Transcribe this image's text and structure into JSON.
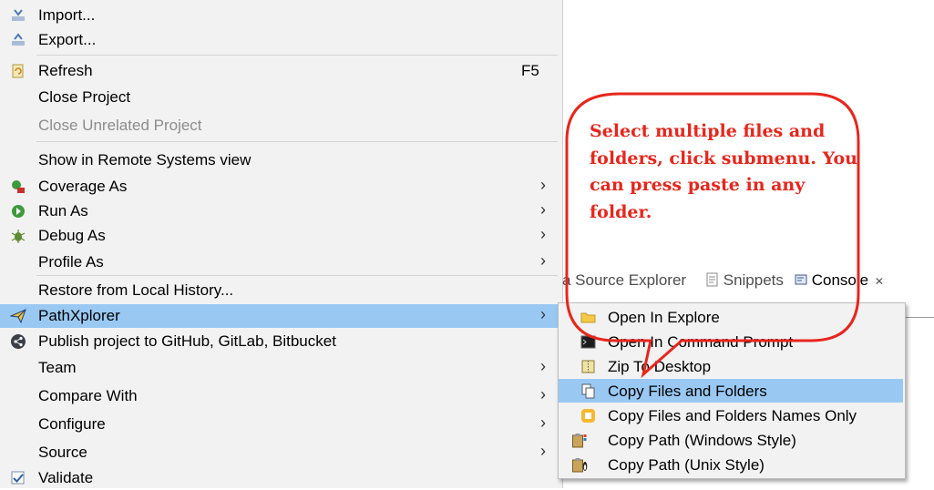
{
  "menu": {
    "import": "Import...",
    "export": "Export...",
    "refresh": "Refresh",
    "refresh_shortcut": "F5",
    "close_project": "Close Project",
    "close_unrelated_project": "Close Unrelated Project",
    "show_remote": "Show in Remote Systems view",
    "coverage_as": "Coverage As",
    "run_as": "Run As",
    "debug_as": "Debug As",
    "profile_as": "Profile As",
    "restore_history": "Restore from Local History...",
    "pathxplorer": "PathXplorer",
    "publish": "Publish project to GitHub, GitLab, Bitbucket",
    "team": "Team",
    "compare_with": "Compare With",
    "configure": "Configure",
    "source": "Source",
    "validate": "Validate",
    "arrow": "›"
  },
  "tabs": {
    "source_explorer": "a Source Explorer",
    "snippets": "Snippets",
    "console": "Console",
    "close": "✕"
  },
  "submenu": {
    "open_explore": "Open In Explore",
    "open_cmd": "Open In Command Prompt",
    "zip_desktop": "Zip To Desktop",
    "copy_files": "Copy Files and Folders",
    "copy_names": "Copy Files and Folders Names Only",
    "copy_windows": "Copy Path (Windows Style)",
    "copy_unix": "Copy Path (Unix Style)"
  },
  "callout": {
    "line1": "Select multiple files and",
    "line2": "folders, click submenu. You",
    "line3": "can press paste in any",
    "line4": "folder.",
    "color": "#e8261c"
  },
  "colors": {
    "highlight": "#99c9f3",
    "menu_bg": "#f2f2f2"
  }
}
